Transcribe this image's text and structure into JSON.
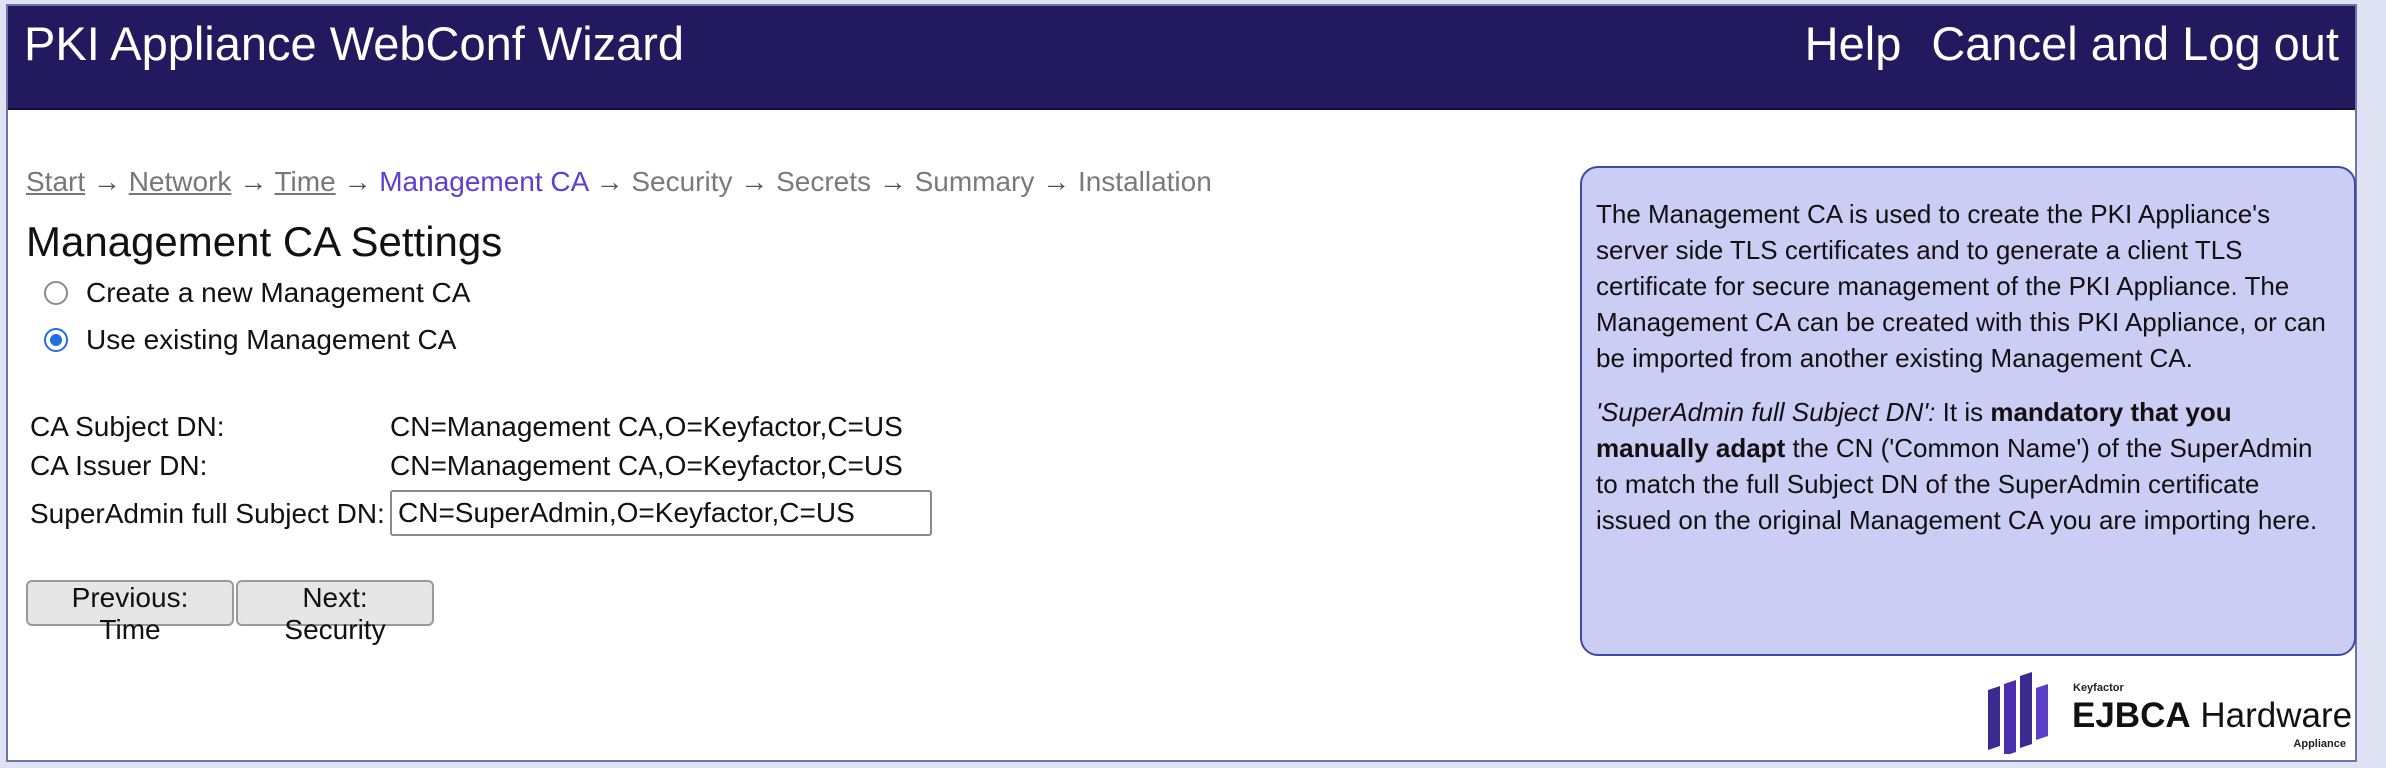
{
  "header": {
    "title": "PKI Appliance WebConf Wizard",
    "help": "Help",
    "cancel": "Cancel and Log out",
    "bg_color": "#23195e"
  },
  "breadcrumb": {
    "steps": [
      "Start",
      "Network",
      "Time",
      "Management CA",
      "Security",
      "Secrets",
      "Summary",
      "Installation"
    ],
    "current": "Management CA",
    "arrow": "→"
  },
  "page_title": "Management CA Settings",
  "options": {
    "create": "Create a new Management CA",
    "use_existing": "Use existing Management CA",
    "selected": "use_existing"
  },
  "fields": {
    "subject_label": "CA Subject DN:",
    "subject_value": "CN=Management CA,O=Keyfactor,C=US",
    "issuer_label": "CA Issuer DN:",
    "issuer_value": "CN=Management CA,O=Keyfactor,C=US",
    "superadmin_label": "SuperAdmin full Subject DN:",
    "superadmin_value": "CN=SuperAdmin,O=Keyfactor,C=US"
  },
  "buttons": {
    "previous": "Previous: Time",
    "next": "Next: Security"
  },
  "info": {
    "p1": "The Management CA is used to create the PKI Appliance's server side TLS certificates and to generate a client TLS certificate for secure management of the PKI Appliance. The Management CA can be created with this PKI Appliance, or can be imported from another existing Management CA.",
    "p2_italic": "'SuperAdmin full Subject DN':",
    "p2_a": " It is ",
    "p2_bold": "mandatory that you manually adapt",
    "p2_b": " the CN ('Common Name') of the SuperAdmin to match the full Subject DN of the SuperAdmin certificate issued on the original Management CA you are importing here.",
    "bg_color": "#cbcdf4"
  },
  "logo": {
    "brand": "Keyfactor",
    "name_bold": "EJBCA",
    "name_rest": " Hardware",
    "sub": "Appliance",
    "mark_color": "#3b2a8f"
  }
}
